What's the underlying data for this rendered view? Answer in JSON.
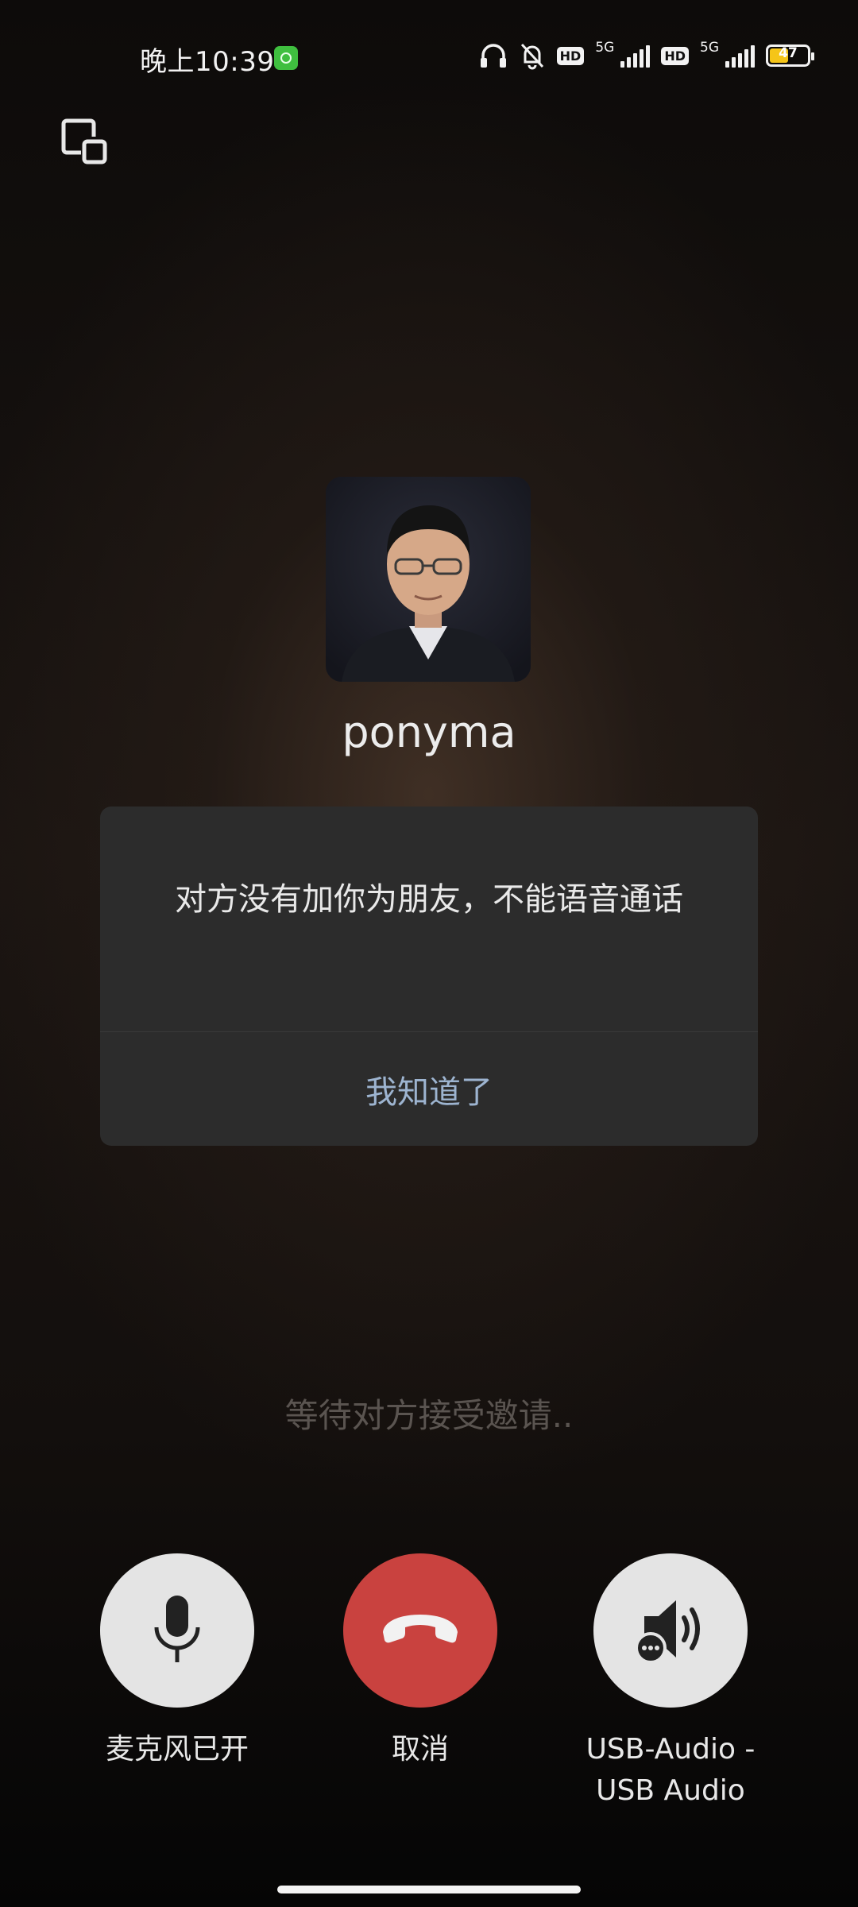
{
  "status_bar": {
    "time": "晚上10:39",
    "hd1": "HD",
    "net1": "5G",
    "hd2": "HD",
    "net2": "5G",
    "battery_level": "47",
    "icons": [
      "wechat-notification-icon",
      "headphones-icon",
      "bell-off-icon",
      "signal-icon",
      "battery-icon"
    ]
  },
  "top": {
    "float_window_icon": "floating-window-icon"
  },
  "caller": {
    "name": "ponyma"
  },
  "dialog": {
    "message": "对方没有加你为朋友，不能语音通话",
    "button_label": "我知道了"
  },
  "call_status": "等待对方接受邀请..",
  "controls": {
    "mic_label": "麦克风已开",
    "cancel_label": "取消",
    "audio_label_line1": "USB-Audio -",
    "audio_label_line2": "USB Audio"
  },
  "colors": {
    "hangup": "#c9423f",
    "control_bg": "#e4e4e4",
    "dialog_bg": "#2c2c2c",
    "dialog_button": "#9db4d0",
    "battery_fill": "#f5c518"
  }
}
